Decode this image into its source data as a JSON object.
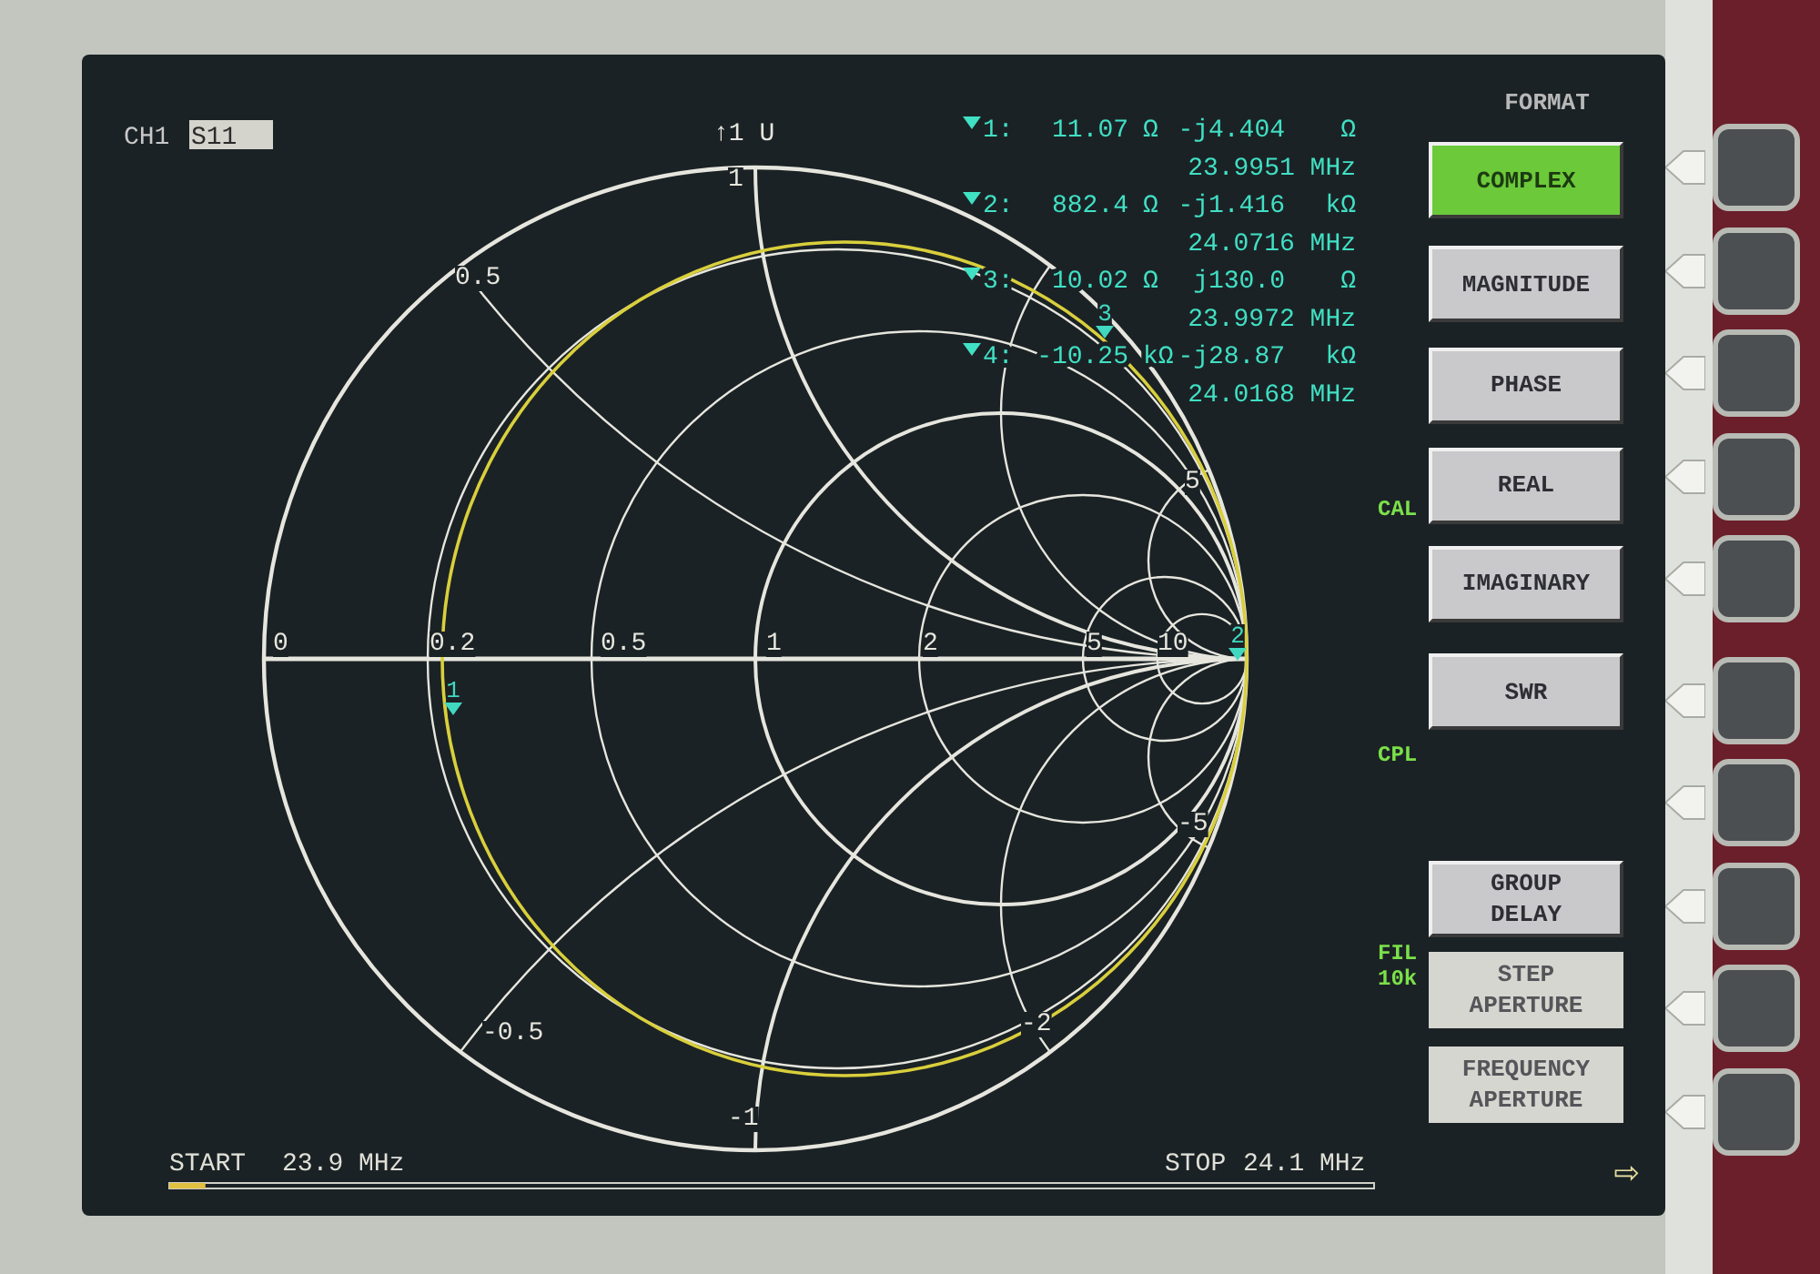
{
  "channel": {
    "label": "CH1",
    "parameter": "S11"
  },
  "scale": "↑1 U",
  "markers": [
    {
      "id": "1:",
      "real": "11.07",
      "real_unit": "Ω",
      "imag": "-j4.404",
      "imag_unit": "Ω",
      "freq": "23.9951 MHz"
    },
    {
      "id": "2:",
      "real": "882.4",
      "real_unit": "Ω",
      "imag": "-j1.416",
      "imag_unit": "kΩ",
      "freq": "24.0716 MHz"
    },
    {
      "id": "3:",
      "real": "10.02",
      "real_unit": "Ω",
      "imag": "j130.0",
      "imag_unit": "Ω",
      "freq": "23.9972 MHz"
    },
    {
      "id": "4:",
      "real": "-10.25",
      "real_unit": "kΩ",
      "imag": "-j28.87",
      "imag_unit": "kΩ",
      "freq": "24.0168 MHz"
    }
  ],
  "smith_chart": {
    "real_labels": [
      "0",
      "0.2",
      "0.5",
      "1",
      "2",
      "5",
      "10"
    ],
    "imag_labels": [
      "1",
      "0.5",
      "5",
      "-5",
      "-2",
      "-0.5",
      "-1"
    ],
    "trace_markers": [
      {
        "label": "1"
      },
      {
        "label": "3"
      },
      {
        "label": "2"
      }
    ]
  },
  "side_annotations": [
    "CAL",
    "CPL",
    "FIL",
    "10k"
  ],
  "menu": {
    "title": "FORMAT",
    "softkeys": [
      {
        "label": "COMPLEX",
        "selected": true,
        "disabled": false
      },
      {
        "label": "MAGNITUDE",
        "selected": false,
        "disabled": false
      },
      {
        "label": "PHASE",
        "selected": false,
        "disabled": false
      },
      {
        "label": "REAL",
        "selected": false,
        "disabled": false
      },
      {
        "label": "IMAGINARY",
        "selected": false,
        "disabled": false
      },
      {
        "label": "SWR",
        "selected": false,
        "disabled": false
      },
      {
        "label": "GROUP DELAY",
        "selected": false,
        "disabled": false
      },
      {
        "label": "STEP APERTURE",
        "selected": false,
        "disabled": true
      },
      {
        "label": "FREQUENCY APERTURE",
        "selected": false,
        "disabled": true
      }
    ]
  },
  "sweep": {
    "start_label": "START",
    "start_value": "23.9 MHz",
    "stop_label": "STOP",
    "stop_value": "24.1 MHz",
    "next_page": "⇨",
    "level": 0.03
  }
}
